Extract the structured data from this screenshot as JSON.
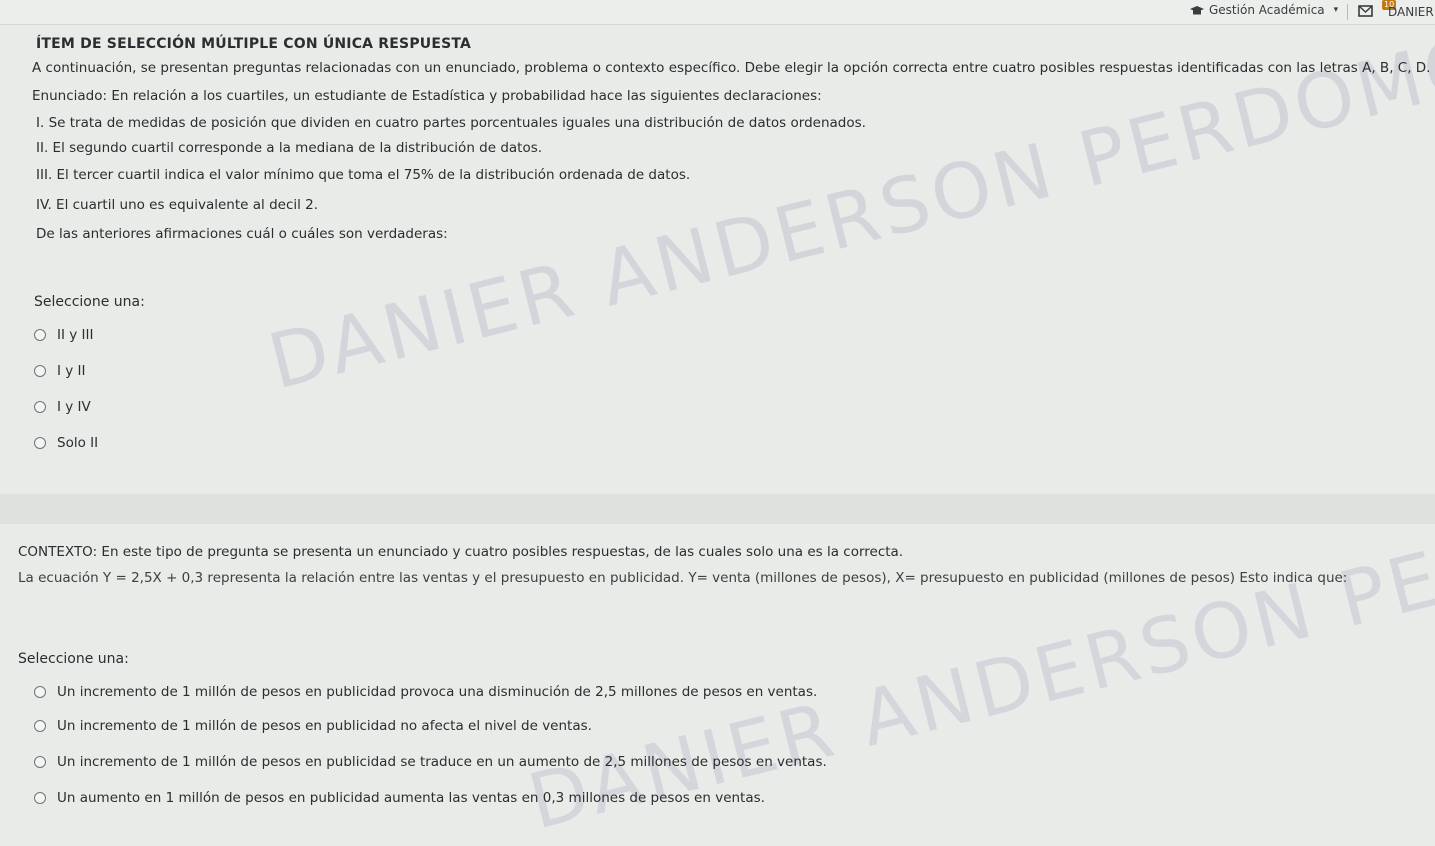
{
  "topbar": {
    "section_label": "Gestión Académica",
    "notification_count": "10",
    "user_name": "DANIER"
  },
  "watermark": {
    "name_top": "DANIER ANDERSON PERDOMO CARMONA",
    "name_bottom": "DANIER ANDERSON PERDOMO CARMONA"
  },
  "question1": {
    "title": "ÍTEM DE SELECCIÓN MÚLTIPLE CON ÚNICA RESPUESTA",
    "intro": "A continuación, se presentan preguntas relacionadas con un enunciado, problema o contexto específico. Debe elegir la opción correcta entre cuatro posibles respuestas identificadas con las letras A, B, C, D.",
    "statement": "Enunciado: En relación a los cuartiles, un estudiante de Estadística y probabilidad hace las siguientes declaraciones:",
    "claims": [
      "I. Se trata de medidas de posición que dividen en cuatro partes porcentuales iguales una distribución de datos ordenados.",
      "II. El segundo cuartil corresponde a la mediana de la distribución de datos.",
      "III. El tercer cuartil indica el valor mínimo que toma el 75% de la distribución ordenada de datos.",
      "IV. El cuartil uno es equivalente al decil 2."
    ],
    "prompt": "De las anteriores afirmaciones cuál o cuáles son verdaderas:",
    "select_label": "Seleccione una:",
    "options": [
      "II y III",
      "I y II",
      "I y IV",
      "Solo II"
    ]
  },
  "question2": {
    "context": "CONTEXTO: En este tipo de pregunta se presenta un enunciado y cuatro posibles respuestas, de las cuales solo una es la correcta.",
    "equation_text": "La ecuación Y = 2,5X + 0,3 representa la relación entre las ventas y el presupuesto en publicidad. Y= venta (millones de pesos), X= presupuesto en publicidad (millones de pesos) Esto indica que:",
    "select_label": "Seleccione una:",
    "options": [
      "Un incremento de 1 millón de pesos en publicidad provoca una disminución de 2,5 millones de pesos en ventas.",
      "Un incremento de 1 millón de pesos en publicidad no afecta el nivel de ventas.",
      "Un incremento de 1 millón de pesos en publicidad se traduce en un aumento de 2,5 millones de pesos en ventas.",
      "Un aumento en 1 millón de pesos en publicidad aumenta las ventas en 0,3 millones de pesos en ventas."
    ]
  }
}
